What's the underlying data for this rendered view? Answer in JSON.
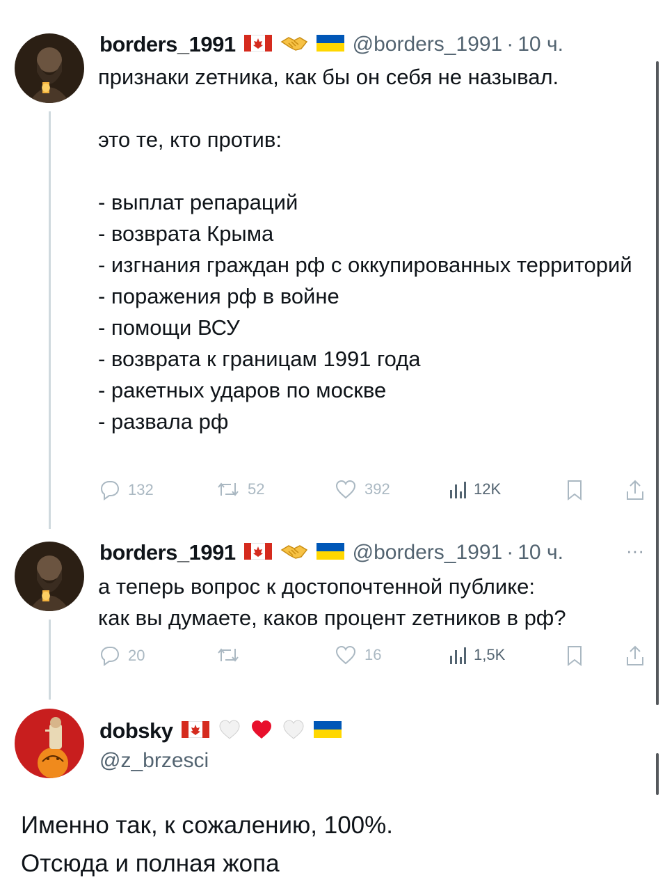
{
  "tweets": [
    {
      "name": "borders_1991",
      "handle": "@borders_1991",
      "dot": "·",
      "time": "10 ч.",
      "text": "признаки zетника, как бы он себя не называл.\n\nэто те, кто против:\n\n- выплат репараций\n- возврата Крыма\n- изгнания граждан рф с оккупированных территорий\n- поражения рф в войне\n- помощи ВСУ\n- возврата к границам 1991 года\n- ракетных ударов по москве\n- развала рф",
      "replies": "132",
      "retweets": "52",
      "likes": "392",
      "views": "12K"
    },
    {
      "name": "borders_1991",
      "handle": "@borders_1991",
      "dot": "·",
      "time": "10 ч.",
      "more": "···",
      "text": "а теперь вопрос к достопочтенной публике:\nкак вы думаете, каков процент zетников в рф?",
      "replies": "20",
      "retweets": "",
      "likes": "16",
      "views": "1,5K"
    }
  ],
  "reply": {
    "name": "dobsky",
    "handle": "@z_brzesci",
    "text": "Именно так, к сожалению, 100%.\nОтсюда и полная жопа"
  },
  "icons": [
    "canada-flag-icon",
    "handshake-icon",
    "ukraine-flag-icon",
    "white-heart-icon",
    "red-heart-icon",
    "reply-icon",
    "retweet-icon",
    "like-icon",
    "views-icon",
    "bookmark-icon",
    "share-icon"
  ],
  "colors": {
    "text": "#0f1419",
    "muted": "#536471",
    "faded": "#aab8c2",
    "line": "#cfd9de",
    "ukraine_blue": "#0057b7",
    "ukraine_yellow": "#ffd700",
    "canada_red": "#d52b1e"
  }
}
